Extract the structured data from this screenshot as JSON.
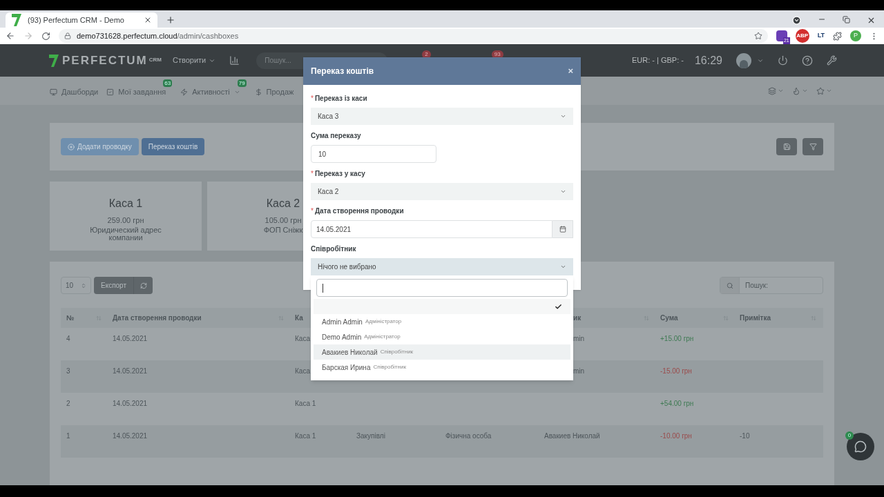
{
  "browser": {
    "tab_title": "(93) Perfectum CRM - Demo",
    "url_host": "demo731628.perfectum.cloud",
    "url_path": "/admin/cashboxes",
    "extension_badge": "21",
    "extension_label": "ABP",
    "extension_lt": "LT",
    "profile": "P"
  },
  "header": {
    "logo": "PERFECTUM",
    "logo_sup": "CRM",
    "create": "Створити",
    "search_placeholder": "Пошук...",
    "badges": [
      "2",
      "93"
    ],
    "currency": "EUR: - | GBP: -",
    "time": "16:29"
  },
  "nav": {
    "items": [
      {
        "label": "Дашборди"
      },
      {
        "label": "Мої завдання",
        "badge": "63"
      },
      {
        "label": "Активності",
        "badge": "79"
      },
      {
        "label": "Продаж"
      }
    ]
  },
  "toolbar": {
    "buttons": [
      {
        "label": "Додати проводку",
        "kind": "add"
      },
      {
        "label": "Переказ коштів",
        "kind": "transfer"
      }
    ]
  },
  "cards": [
    {
      "title": "Каса 1",
      "amount": "259.00 грн",
      "subtitle": "Юридический адрес компании"
    },
    {
      "title": "Каса 2",
      "amount": "105.00 грн",
      "subtitle": "ФОП Сніжк"
    }
  ],
  "table": {
    "page_size": "10",
    "export": "Експорт",
    "search_placeholder": "Пошук:",
    "columns": [
      {
        "label": "№"
      },
      {
        "label": "Дата створення проводки"
      },
      {
        "label": "Ка"
      },
      {},
      {},
      {
        "label": "ик"
      },
      {
        "label": "Сума"
      },
      {
        "label": "Примітка"
      }
    ],
    "rows": [
      {
        "cells": [
          "4",
          "14.05.2021",
          "Каса",
          null,
          null,
          "min",
          "+15.00 грн",
          null
        ],
        "color": "#3e7a52"
      },
      {
        "cells": [
          "3",
          "14.05.2021",
          "Каса",
          null,
          null,
          "min",
          "-15.00 грн",
          null
        ],
        "color": "#9a4a4a"
      },
      {
        "cells": [
          "2",
          "14.05.2021",
          "Каса 1",
          null,
          null,
          null,
          "+54.00 грн",
          null
        ],
        "color": "#3e7a52"
      },
      {
        "cells": [
          "1",
          "14.05.2021",
          "Каса 1",
          "Закупівлі",
          "Фізична особа",
          "Авакиев Николай",
          "-10.00 грн",
          "-10"
        ],
        "color": "#9a4a4a"
      }
    ]
  },
  "chat": {
    "badge": "0"
  },
  "modal": {
    "title": "Переказ коштів",
    "close": "×",
    "fields": [
      {
        "kind": "select",
        "required_mark": "*",
        "label": "Переказ із каси",
        "value": "Каса 3"
      },
      {
        "kind": "input",
        "label": "Сума переказу",
        "value": "10"
      },
      {
        "kind": "select",
        "required_mark": "*",
        "label": "Переказ у касу",
        "value": "Каса 2"
      },
      {
        "kind": "date",
        "required_mark": "*",
        "label": "Дата створення проводки",
        "value": "14.05.2021"
      },
      {
        "kind": "dropdown",
        "label": "Співробітник",
        "value": "Нічого не вибрано",
        "open": true
      }
    ],
    "dropdown": {
      "options": [
        {
          "selected": true,
          "highlighted": false
        },
        {
          "name": "Admin Admin",
          "role": "Адміністратор",
          "selected": false,
          "highlighted": false
        },
        {
          "name": "Demo Admin",
          "role": "Адміністратор",
          "selected": false,
          "highlighted": false
        },
        {
          "name": "Авакиев Николай",
          "role": "Співробітник",
          "selected": false,
          "highlighted": true
        },
        {
          "name": "Барская Ирина",
          "role": "Співробітник",
          "selected": false,
          "highlighted": false
        }
      ]
    }
  }
}
